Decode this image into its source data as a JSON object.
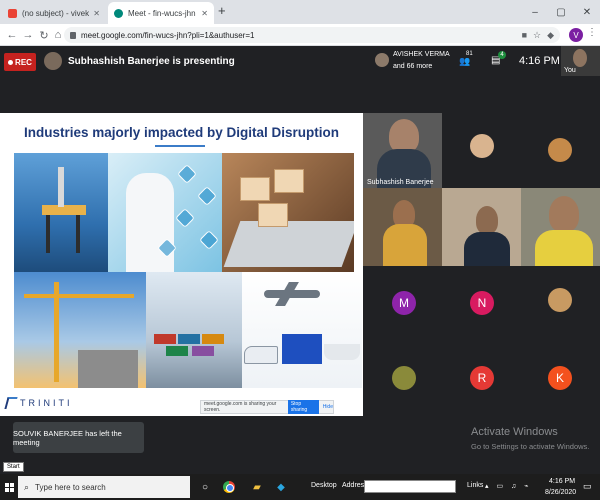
{
  "browser": {
    "tabs": [
      {
        "title": "(no subject) - vivekpachauri@ti..."
      },
      {
        "title": "Meet - fin-wucs-jhn"
      }
    ],
    "new_tab": "+",
    "window_controls": [
      "–",
      "▢",
      "✕"
    ],
    "url": "meet.google.com/fin-wucs-jhn?pli=1&authuser=1",
    "profile_initial": "V"
  },
  "meet": {
    "rec_label": "REC",
    "presenting_text": "Subhashish Banerjee is presenting",
    "participants_preview": {
      "name": "AVISHEK VERMA",
      "more": "and 66 more"
    },
    "people_count": "81",
    "chat_badge": "4",
    "time": "4:16 PM",
    "self_label": "You"
  },
  "slide": {
    "title": "Industries majorly impacted by Digital Disruption",
    "logo_text": "TRINITI",
    "share_bar": {
      "text": "meet.google.com is sharing your screen.",
      "stop": "Stop sharing",
      "hide": "Hide"
    }
  },
  "participants": [
    {
      "name": "Subhashish Banerjee",
      "type": "video"
    },
    {
      "name": "",
      "type": "photo"
    },
    {
      "name": "",
      "type": "photo"
    },
    {
      "name": "",
      "type": "video"
    },
    {
      "name": "",
      "type": "video"
    },
    {
      "name": "",
      "type": "video"
    },
    {
      "initial": "M",
      "color": "#8e24aa"
    },
    {
      "initial": "N",
      "color": "#d81b60"
    },
    {
      "name": "",
      "type": "photo"
    },
    {
      "name": "",
      "type": "photo"
    },
    {
      "initial": "R",
      "color": "#e53935"
    },
    {
      "initial": "K",
      "color": "#f4511e"
    }
  ],
  "notifications": {
    "left_meeting": "SOUVIK BANERJEE has left the meeting"
  },
  "watermark": {
    "line1": "Activate Windows",
    "line2": "Go to Settings to activate Windows."
  },
  "taskbar": {
    "start_tooltip": "Start",
    "search_placeholder": "Type here to search",
    "desktop_label": "Desktop",
    "address_label": "Address",
    "links_label": "Links",
    "clock_time": "4:16 PM",
    "clock_date": "8/26/2020"
  }
}
